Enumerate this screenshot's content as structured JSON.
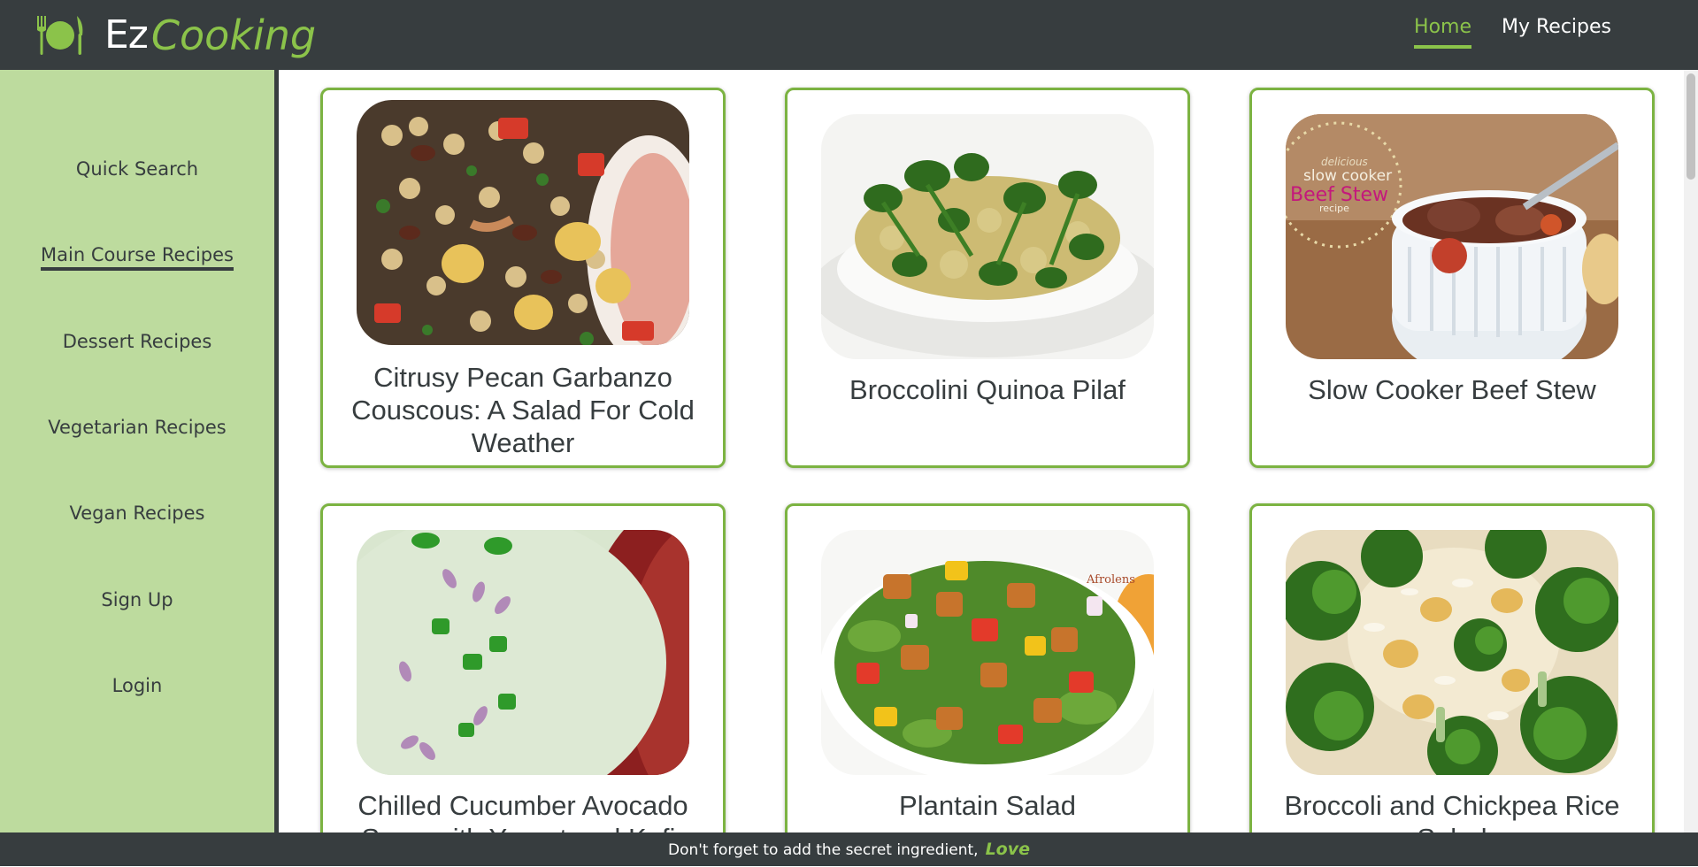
{
  "header": {
    "logo_ez": "Ez",
    "logo_cooking": "Cooking",
    "nav": [
      {
        "label": "Home",
        "active": true
      },
      {
        "label": "My Recipes",
        "active": false
      }
    ]
  },
  "sidebar": {
    "items": [
      {
        "label": "Quick Search"
      },
      {
        "label": "Main Course Recipes",
        "active": true
      },
      {
        "label": "Dessert Recipes"
      },
      {
        "label": "Vegetarian Recipes"
      },
      {
        "label": "Vegan Recipes"
      },
      {
        "label": "Sign Up"
      },
      {
        "label": "Login"
      }
    ]
  },
  "recipes": [
    {
      "title": "Citrusy Pecan Garbanzo Couscous: A Salad For Cold Weather"
    },
    {
      "title": "Broccolini Quinoa Pilaf"
    },
    {
      "title": "Slow Cooker Beef Stew",
      "image_caption_1": "delicious",
      "image_caption_2": "slow cooker",
      "image_caption_3": "Beef Stew",
      "image_caption_4": "recipe"
    },
    {
      "title": "Chilled Cucumber Avocado Soup with Yogurt and Kefir"
    },
    {
      "title": "Plantain Salad",
      "image_watermark": "Afrolens"
    },
    {
      "title": "Broccoli and Chickpea Rice Salad"
    }
  ],
  "footer": {
    "text": "Don't forget to add the secret ingredient,",
    "love": "Love"
  },
  "colors": {
    "header_bg": "#373d3f",
    "accent": "#8bc34a",
    "sidebar_bg": "#bddb9e",
    "card_border": "#7cb342"
  }
}
